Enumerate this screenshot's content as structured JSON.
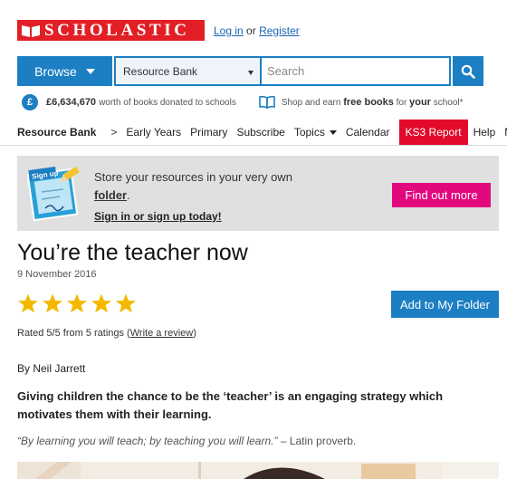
{
  "header": {
    "logo_text": "SCHOLASTIC",
    "login_label": "Log in",
    "or_text": "or",
    "register_label": "Register"
  },
  "search": {
    "browse_label": "Browse",
    "select_value": "Resource Bank",
    "placeholder": "Search"
  },
  "donation": {
    "amount": "£6,634,670",
    "text": "worth of books donated to schools",
    "shop_text": "Shop and earn",
    "free_books": "free books",
    "for_text": "for",
    "your_school": "your",
    "school_text": "school*"
  },
  "nav": {
    "items": [
      "Resource Bank",
      "Early Years",
      "Primary",
      "Subscribe",
      "Topics",
      "Calendar",
      "KS3 Report",
      "Help",
      "M"
    ],
    "separator": ">"
  },
  "banner": {
    "line1": "Store your resources in your very own",
    "folder": "folder",
    "period": ".",
    "signin": "Sign in or sign up today!",
    "button": "Find out more",
    "graphic_label": "Sign up"
  },
  "article": {
    "title": "You’re the teacher now",
    "date": "9 November 2016",
    "rating_stars": 5,
    "add_button": "Add to My Folder",
    "rated_prefix": "Rated 5/5 from 5 ratings (",
    "write_review": "Write a review",
    "rated_suffix": ")",
    "author": "By Neil Jarrett",
    "lead": "Giving children the chance to be the ‘teacher’ is an engaging strategy which motivates them with their learning.",
    "quote": "“By learning you will teach; by teaching you will learn.”",
    "quote_source": " – Latin proverb."
  },
  "colors": {
    "brand_red": "#e21f26",
    "primary_blue": "#1d7fc3",
    "ks3_red": "#e2092a",
    "magenta": "#e2097f",
    "star_gold": "#f5b800"
  }
}
